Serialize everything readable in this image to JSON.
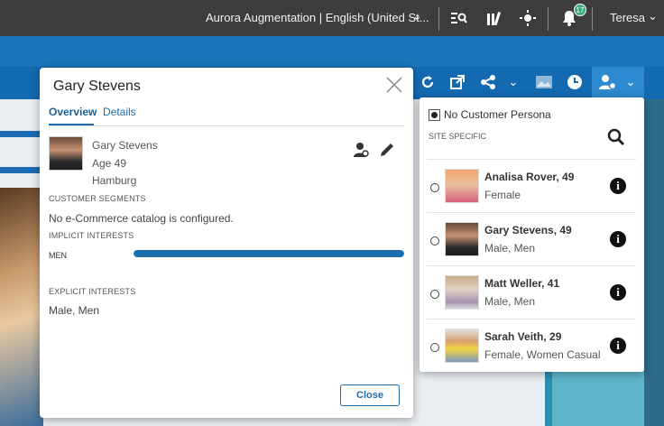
{
  "topbar": {
    "site_selector": "Aurora Augmentation | English (United St...",
    "notification_count": "17",
    "user_name": "Teresa"
  },
  "modal": {
    "title": "Gary Stevens",
    "tabs": [
      {
        "label": "Overview",
        "active": true
      },
      {
        "label": "Details",
        "active": false
      }
    ],
    "profile": {
      "name": "Gary Stevens",
      "age": "Age 49",
      "city": "Hamburg"
    },
    "customer_segments_label": "CUSTOMER SEGMENTS",
    "catalog_message": "No e-Commerce catalog is configured.",
    "implicit_interests_label": "IMPLICIT INTERESTS",
    "implicit_interests": [
      {
        "label": "MEN",
        "level": 1.0
      }
    ],
    "explicit_interests_label": "EXPLICIT INTERESTS",
    "explicit_interests_value": "Male, Men",
    "close_label": "Close"
  },
  "persona_dropdown": {
    "no_persona_label": "No Customer Persona",
    "section_label": "SITE SPECIFIC",
    "personas": [
      {
        "name": "Analisa Rover, 49",
        "detail": "Female"
      },
      {
        "name": "Gary Stevens, 49",
        "detail": "Male, Men"
      },
      {
        "name": "Matt Weller, 41",
        "detail": "Male, Men"
      },
      {
        "name": "Sarah Veith, 29",
        "detail": "Female, Women Casual"
      }
    ]
  },
  "colors": {
    "brand_blue": "#1b6db0",
    "topbar": "#3d3d3d",
    "badge_green": "#3aa877"
  }
}
